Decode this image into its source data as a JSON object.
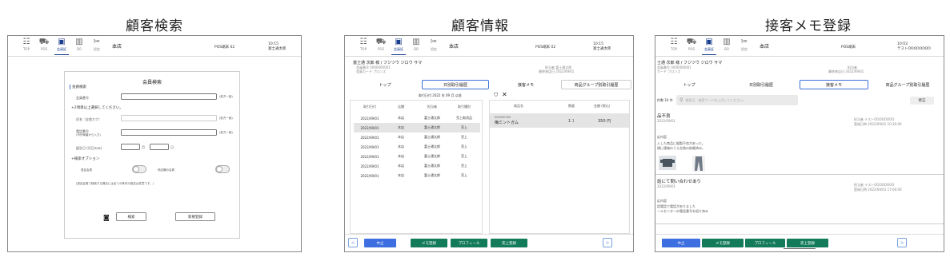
{
  "titles": {
    "search": "顧客検索",
    "info": "顧客情報",
    "memo": "接客メモ登録"
  },
  "nav": {
    "items": [
      {
        "label": "TOP",
        "icon": "list-icon"
      },
      {
        "label": "POS",
        "icon": "cart-icon"
      },
      {
        "label": "会員証",
        "icon": "card-icon"
      },
      {
        "label": "BO",
        "icon": "chart-icon"
      },
      {
        "label": "設定",
        "icon": "tools-icon"
      }
    ],
    "store": "本店"
  },
  "screen1": {
    "terminal": "POS端末 02",
    "time": "10:15",
    "user": "富士通太郎",
    "heading": "会員検索",
    "section_member": "会員検索",
    "member_no_label": "会員番号",
    "member_no_hint": "(前方一致)",
    "instruction": "+2項目以上選択してください。",
    "name_label": "氏名（全角カナ）",
    "name_hint": "(前方一致)",
    "phone_label": "電話番号",
    "phone_sub": "(市外局番から入力)",
    "phone_hint": "(前方一致)",
    "birth_label": "誕生日 (月日のみ)",
    "month_unit": "月",
    "day_unit": "日",
    "options_label": "+検索オプション",
    "opt1": "退会会員",
    "opt2": "他店舗の会員",
    "note": "(退会会員で検索する場合には全ての条件の指定は任意です。)",
    "search_btn": "検索",
    "register_btn": "新規登録"
  },
  "screen2": {
    "terminal": "POS端末 02",
    "time": "10:15",
    "user": "富士通太郎",
    "customer_name": "富士通 次郎 様 / フジツウ ジロウ サマ",
    "member_no": "会員番号 0000000001",
    "member_card": "会員カード プロンズ",
    "store_label": "担当者 富士通太郎",
    "last_visit": "最終来店日 2022/09/01",
    "tabs": [
      "トップ",
      "日別取引履歴",
      "接客メモ",
      "商品グループ別取引履歴"
    ],
    "date_filter": "取引日付 2022 年 09 月 以前",
    "table_headers": [
      "取引日付",
      "店舗",
      "担当者",
      "取引種別"
    ],
    "rows": [
      [
        "2022/09/01",
        "本店",
        "富士通太郎",
        "売上取消品"
      ],
      [
        "2022/09/01",
        "本店",
        "富士通太郎",
        "売上"
      ],
      [
        "2022/09/01",
        "本店",
        "富士通太郎",
        "売上"
      ],
      [
        "2022/09/01",
        "本店",
        "富士通太郎",
        "売上"
      ],
      [
        "2022/09/01",
        "本店",
        "富士通太郎",
        "売上"
      ],
      [
        "2022/09/01",
        "本店",
        "富士通太郎",
        "売上"
      ],
      [
        "2022/09/01",
        "本店",
        "富士通太郎",
        "売上"
      ]
    ],
    "detail_headers": [
      "商品名",
      "数量",
      "金額 (税込)"
    ],
    "detail_code": "000000785",
    "detail_name": "梅ミントガム",
    "detail_qty": "1 ｺ",
    "detail_amount": "350 円",
    "buttons": [
      "中止",
      "メモ登録",
      "プロフィール",
      "売上登録"
    ]
  },
  "screen3": {
    "terminal": "POS端末",
    "time": "10:03",
    "user": "テストOOOOOOOO",
    "customer_name": "士通 次郎 様 / フジツウ ジロウ サマ",
    "member_no": "会員番号 0000000001",
    "member_card": "カード ブロンズ",
    "staff": "担当者",
    "last_visit": "最終来店日 2022/09/01",
    "tabs": [
      "トップ",
      "日別取引履歴",
      "接客メモ",
      "商品グループ別取引履歴"
    ],
    "period": "件数 10 件",
    "search_placeholder": "検索日、検索ワードを入力してください。",
    "edit_btn": "修正",
    "memo1_title": "品不良",
    "memo1_date": "2022/09/01",
    "memo1_staff": "担当者 テストOOOOOOOO",
    "memo1_registered": "登録日時 2022/09/01 10:30:00",
    "memo1_section": "応内容",
    "memo1_body1": "入した商品に縫製不良があった。",
    "memo1_body2": "規に連絡のうえ交換の依頼済み。",
    "memo2_title": "話にて問い合わせあり",
    "memo2_date": "2022/09/01",
    "memo2_staff": "担当者 テストOOOOOOOO",
    "memo2_registered": "登録日時 2022/09/01 17:00:00",
    "memo2_section": "応内容",
    "memo2_body1": "話電話で電話がありました",
    "memo2_body2": "ールセンターの電話番号を紹介済み",
    "buttons": [
      "中止",
      "メモ登録",
      "プロフィール",
      "売上登録"
    ]
  }
}
